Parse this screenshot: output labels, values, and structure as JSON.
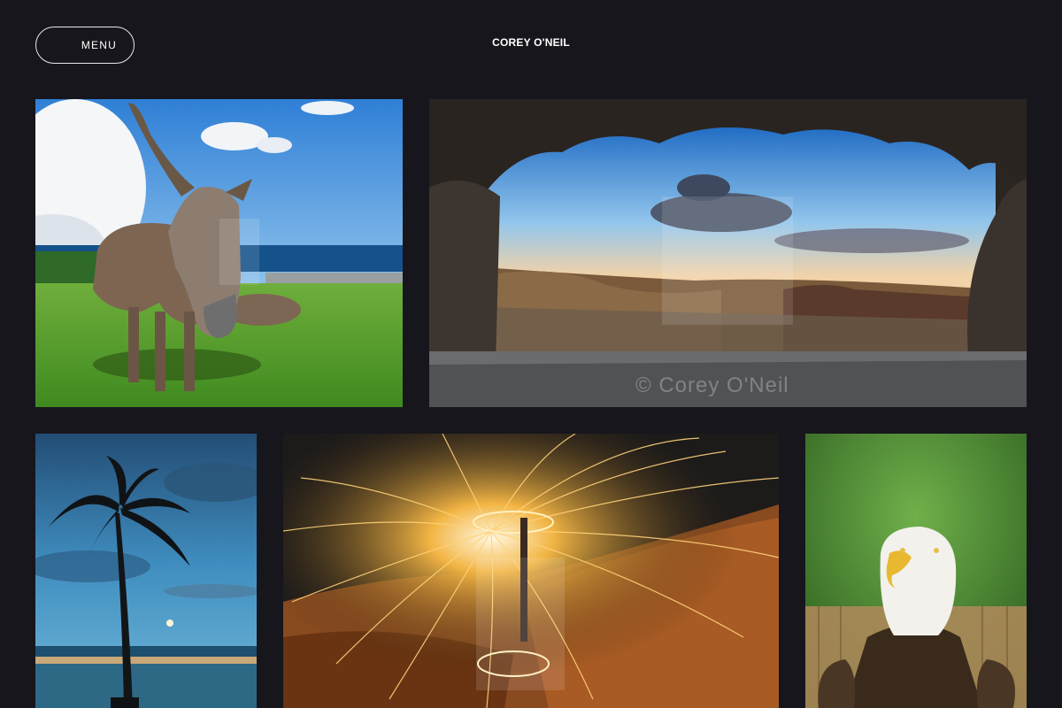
{
  "header": {
    "menu_label": "MENU",
    "site_title": "COREY O'NEIL"
  },
  "gallery": {
    "photos": [
      {
        "subject": "donkey on grassy hill by the ocean"
      },
      {
        "subject": "desert sunset framed by stone window",
        "watermark": "© Corey O'Neil"
      },
      {
        "subject": "palm tree at dusk with moon over beach"
      },
      {
        "subject": "steel wool light painting on rocks"
      },
      {
        "subject": "bald eagle portrait"
      }
    ]
  },
  "colors": {
    "background": "#17161c",
    "text": "#ffffff",
    "menu_border": "#e8e8ea"
  },
  "icons": {
    "menu": "hamburger-icon"
  }
}
